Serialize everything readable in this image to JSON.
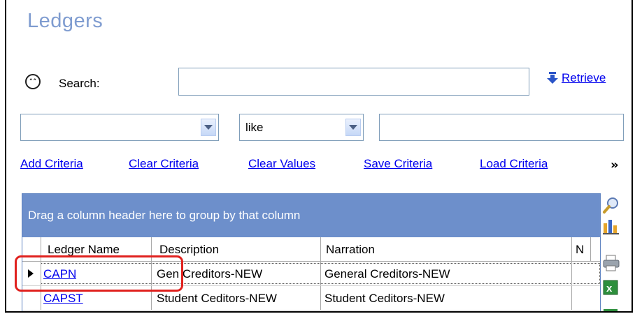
{
  "title": "Ledgers",
  "search": {
    "label": "Search:",
    "value": "",
    "retrieve_label": "Retrieve"
  },
  "criteria": {
    "field_value": "",
    "operator_value": "like",
    "value_input": ""
  },
  "actions": {
    "add_criteria": "Add Criteria",
    "clear_criteria": "Clear Criteria",
    "clear_values": "Clear Values",
    "save_criteria": "Save Criteria",
    "load_criteria": "Load Criteria",
    "more": "»"
  },
  "grid": {
    "group_panel_text": "Drag a column header here to group by that column",
    "columns": [
      "Ledger Name",
      "Description",
      "Narration",
      "N"
    ],
    "rows": [
      {
        "ledger_name": "CAPN",
        "description": "Gen Creditors-NEW",
        "narration": "General Creditors-NEW"
      },
      {
        "ledger_name": "CAPST",
        "description": "Student Ceditors-NEW",
        "narration": "Student Ceditors-NEW"
      }
    ]
  },
  "side_icons": [
    "magnifier-icon",
    "chart-icon",
    "printer-icon",
    "excel-icon"
  ],
  "colors": {
    "title": "#7f9cd0",
    "group_panel": "#6d8fcb",
    "link": "#0000ee",
    "highlight": "#e0211e"
  }
}
